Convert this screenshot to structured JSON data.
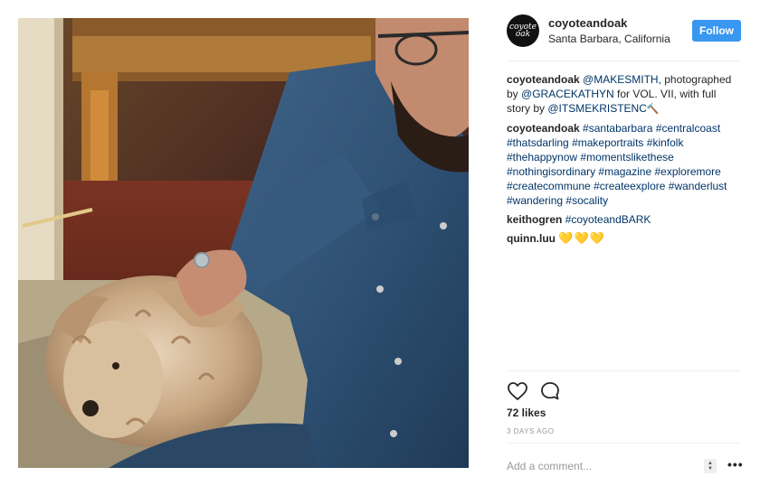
{
  "post": {
    "author": "coyoteandoak",
    "location": "Santa Barbara, California",
    "avatar_text": "coyote oak",
    "follow_label": "Follow"
  },
  "comments": [
    {
      "user": "coyoteandoak",
      "parts": [
        {
          "type": "link",
          "text": "@MAKESMITH"
        },
        {
          "type": "text",
          "text": ", photographed by "
        },
        {
          "type": "link",
          "text": "@GRACEKATHYN"
        },
        {
          "type": "text",
          "text": " for VOL. VII, with full story by "
        },
        {
          "type": "link",
          "text": "@ITSMEKRISTENC"
        },
        {
          "type": "hammer",
          "text": "🔨"
        }
      ]
    },
    {
      "user": "coyoteandoak",
      "parts": [
        {
          "type": "link",
          "text": "#santabarbara"
        },
        {
          "type": "text",
          "text": " "
        },
        {
          "type": "link",
          "text": "#centralcoast"
        },
        {
          "type": "text",
          "text": " "
        },
        {
          "type": "link",
          "text": "#thatsdarling"
        },
        {
          "type": "text",
          "text": " "
        },
        {
          "type": "link",
          "text": "#makeportraits"
        },
        {
          "type": "text",
          "text": " "
        },
        {
          "type": "link",
          "text": "#kinfolk"
        },
        {
          "type": "text",
          "text": " "
        },
        {
          "type": "link",
          "text": "#thehappynow"
        },
        {
          "type": "text",
          "text": " "
        },
        {
          "type": "link",
          "text": "#momentslikethese"
        },
        {
          "type": "text",
          "text": " "
        },
        {
          "type": "link",
          "text": "#nothingisordinary"
        },
        {
          "type": "text",
          "text": " "
        },
        {
          "type": "link",
          "text": "#magazine"
        },
        {
          "type": "text",
          "text": " "
        },
        {
          "type": "link",
          "text": "#exploremore"
        },
        {
          "type": "text",
          "text": " "
        },
        {
          "type": "link",
          "text": "#createcommune"
        },
        {
          "type": "text",
          "text": " "
        },
        {
          "type": "link",
          "text": "#createexplore"
        },
        {
          "type": "text",
          "text": " "
        },
        {
          "type": "link",
          "text": "#wanderlust"
        },
        {
          "type": "text",
          "text": " "
        },
        {
          "type": "link",
          "text": "#wandering"
        },
        {
          "type": "text",
          "text": " "
        },
        {
          "type": "link",
          "text": "#socality"
        }
      ]
    },
    {
      "user": "keithogren",
      "parts": [
        {
          "type": "link",
          "text": "#coyoteandBARK"
        }
      ]
    },
    {
      "user": "quinn.luu",
      "parts": [
        {
          "type": "hearts",
          "text": "💛💛💛"
        }
      ]
    }
  ],
  "actions": {
    "like_icon": "heart-icon",
    "comment_icon": "comment-icon"
  },
  "likes_text": "72 likes",
  "time_text": "3 DAYS AGO",
  "add_comment": {
    "placeholder": "Add a comment...",
    "more_label": "•••"
  },
  "colors": {
    "follow_bg": "#3897f0",
    "link": "#003569",
    "text": "#262626",
    "muted": "#999999"
  }
}
